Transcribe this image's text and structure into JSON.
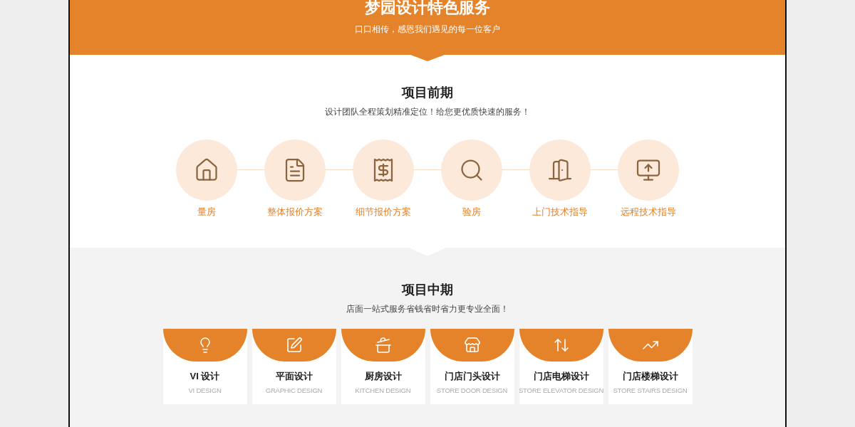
{
  "header": {
    "title": "梦园设计特色服务",
    "subtitle": "口口相传，感恩我们遇见的每一位客户"
  },
  "early": {
    "title": "项目前期",
    "subtitle": "设计团队全程策划精准定位！给您更优质快速的服务！",
    "steps": [
      {
        "label": "量房"
      },
      {
        "label": "整体报价方案"
      },
      {
        "label": "细节报价方案"
      },
      {
        "label": "验房"
      },
      {
        "label": "上门技术指导"
      },
      {
        "label": "远程技术指导"
      }
    ]
  },
  "middle": {
    "title": "项目中期",
    "subtitle": "店面一站式服务省钱省时省力更专业全面！",
    "services": [
      {
        "name": "VI 设计",
        "english": "VI DESIGN"
      },
      {
        "name": "平面设计",
        "english": "GRAPHIC DESIGN"
      },
      {
        "name": "厨房设计",
        "english": "KITCHEN DESIGN"
      },
      {
        "name": "门店门头设计",
        "english": "STORE DOOR DESIGN"
      },
      {
        "name": "门店电梯设计",
        "english": "STORE ELEVATOR DESIGN"
      },
      {
        "name": "门店楼梯设计",
        "english": "STORE STAIRS DESIGN"
      }
    ]
  }
}
